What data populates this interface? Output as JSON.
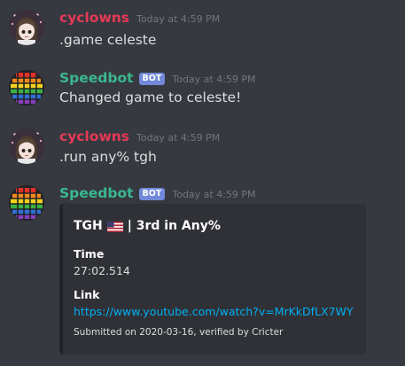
{
  "messages": [
    {
      "author": "cyclowns",
      "timestamp": "Today at 4:59 PM",
      "text": ".game celeste"
    },
    {
      "author": "Speedbot",
      "bot_badge": "BOT",
      "timestamp": "Today at 4:59 PM",
      "text": "Changed game to celeste!"
    },
    {
      "author": "cyclowns",
      "timestamp": "Today at 4:59 PM",
      "text": ".run any% tgh"
    },
    {
      "author": "Speedbot",
      "bot_badge": "BOT",
      "timestamp": "Today at 4:59 PM"
    }
  ],
  "embed": {
    "title_player": "TGH",
    "title_rest": "| 3rd in Any%",
    "flag": "us-flag-icon",
    "fields": [
      {
        "name": "Time",
        "value": "27:02.514"
      },
      {
        "name": "Link",
        "value": "https://www.youtube.com/watch?v=MrKkDfLX7WY"
      }
    ],
    "footer": "Submitted on 2020-03-16, verified by Cricter"
  },
  "colors": {
    "background": "#36393f",
    "cyclowns_name": "#e63956",
    "speedbot_name": "#3bb88f",
    "bot_badge": "#7289da",
    "link": "#00b0f4",
    "embed_bg": "#2f3136"
  }
}
